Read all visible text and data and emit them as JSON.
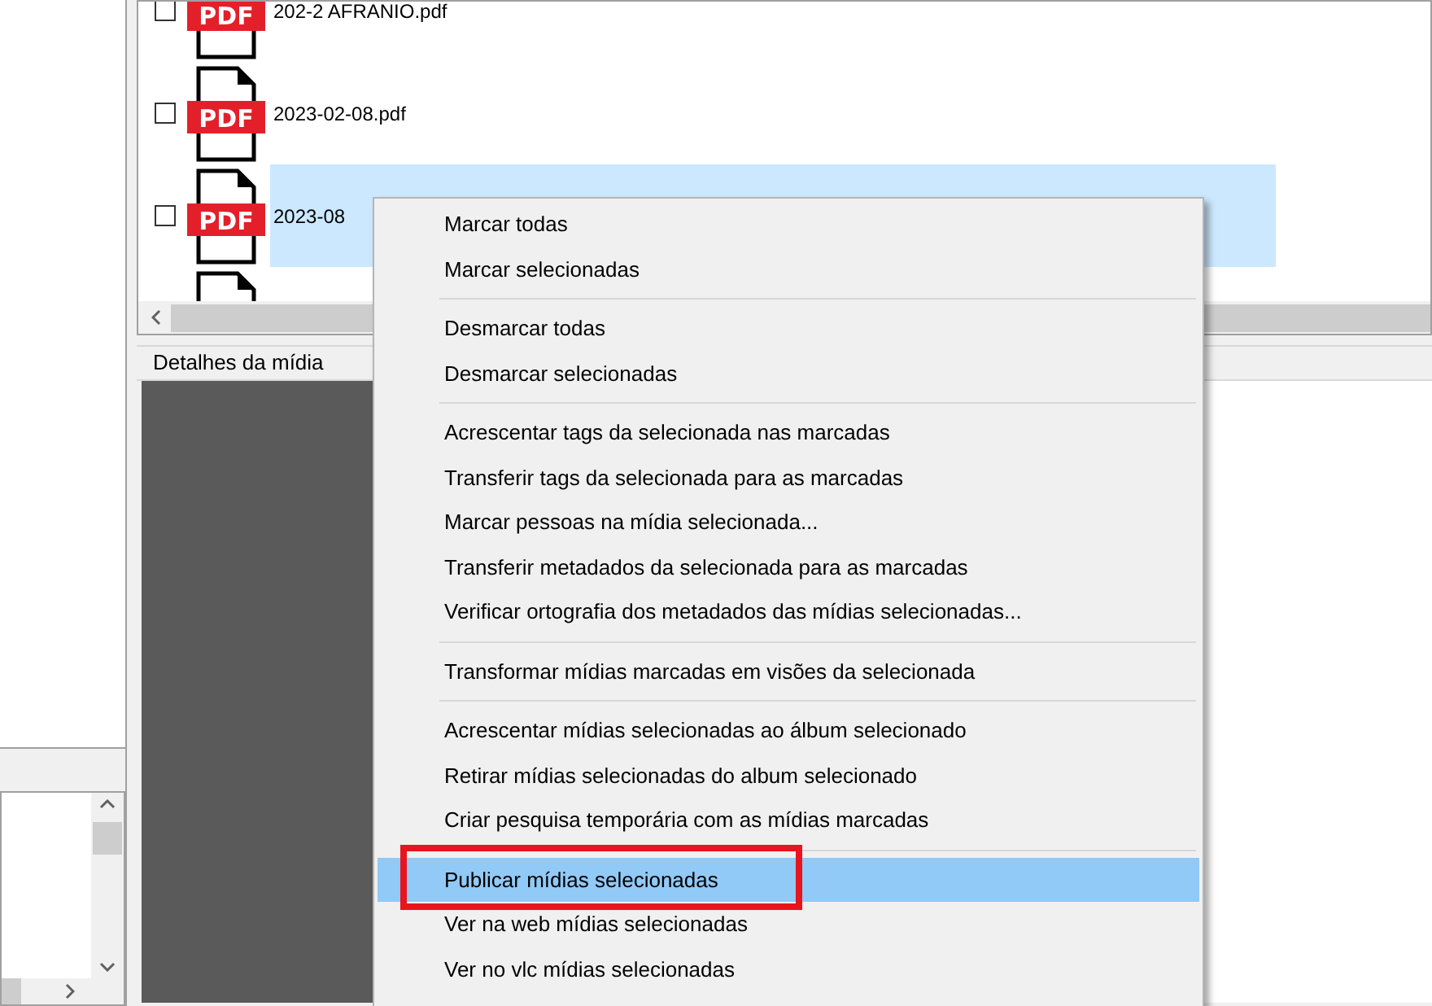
{
  "files": [
    {
      "icon_label": "PDF",
      "name": "202-2 AFRANIO.pdf",
      "checked": false,
      "selected": false
    },
    {
      "icon_label": "PDF",
      "name": "2023-02-08.pdf",
      "checked": false,
      "selected": false
    },
    {
      "icon_label": "PDF",
      "name": "2023-08",
      "checked": false,
      "selected": true
    },
    {
      "selected": false
    }
  ],
  "details_tab": {
    "label": "Detalhes da mídia"
  },
  "context_menu": {
    "items": [
      {
        "kind": "item",
        "label": "Marcar todas",
        "selected": false,
        "outlined": false
      },
      {
        "kind": "item",
        "label": "Marcar selecionadas",
        "selected": false,
        "outlined": false
      },
      {
        "kind": "separator"
      },
      {
        "kind": "item",
        "label": "Desmarcar todas",
        "selected": false,
        "outlined": false
      },
      {
        "kind": "item",
        "label": "Desmarcar selecionadas",
        "selected": false,
        "outlined": false
      },
      {
        "kind": "separator"
      },
      {
        "kind": "item",
        "label": "Acrescentar tags da selecionada nas marcadas",
        "selected": false,
        "outlined": false
      },
      {
        "kind": "item",
        "label": "Transferir tags da selecionada para as marcadas",
        "selected": false,
        "outlined": false
      },
      {
        "kind": "item",
        "label": "Marcar pessoas na mídia selecionada...",
        "selected": false,
        "outlined": false
      },
      {
        "kind": "item",
        "label": "Transferir metadados da selecionada para as marcadas",
        "selected": false,
        "outlined": false
      },
      {
        "kind": "item",
        "label": "Verificar ortografia dos metadados das mídias selecionadas...",
        "selected": false,
        "outlined": false
      },
      {
        "kind": "separator"
      },
      {
        "kind": "item",
        "label": "Transformar mídias marcadas em visões da selecionada",
        "selected": false,
        "outlined": false
      },
      {
        "kind": "separator"
      },
      {
        "kind": "item",
        "label": "Acrescentar mídias selecionadas ao álbum selecionado",
        "selected": false,
        "outlined": false
      },
      {
        "kind": "item",
        "label": "Retirar mídias selecionadas do album selecionado",
        "selected": false,
        "outlined": false
      },
      {
        "kind": "item",
        "label": "Criar pesquisa temporária com as mídias marcadas",
        "selected": false,
        "outlined": false
      },
      {
        "kind": "separator"
      },
      {
        "kind": "item",
        "label": "Publicar mídias selecionadas",
        "selected": true,
        "outlined": true
      },
      {
        "kind": "item",
        "label": "Ver na web mídias selecionadas",
        "selected": false,
        "outlined": false
      },
      {
        "kind": "item",
        "label": "Ver no vlc mídias selecionadas",
        "selected": false,
        "outlined": false
      }
    ]
  }
}
